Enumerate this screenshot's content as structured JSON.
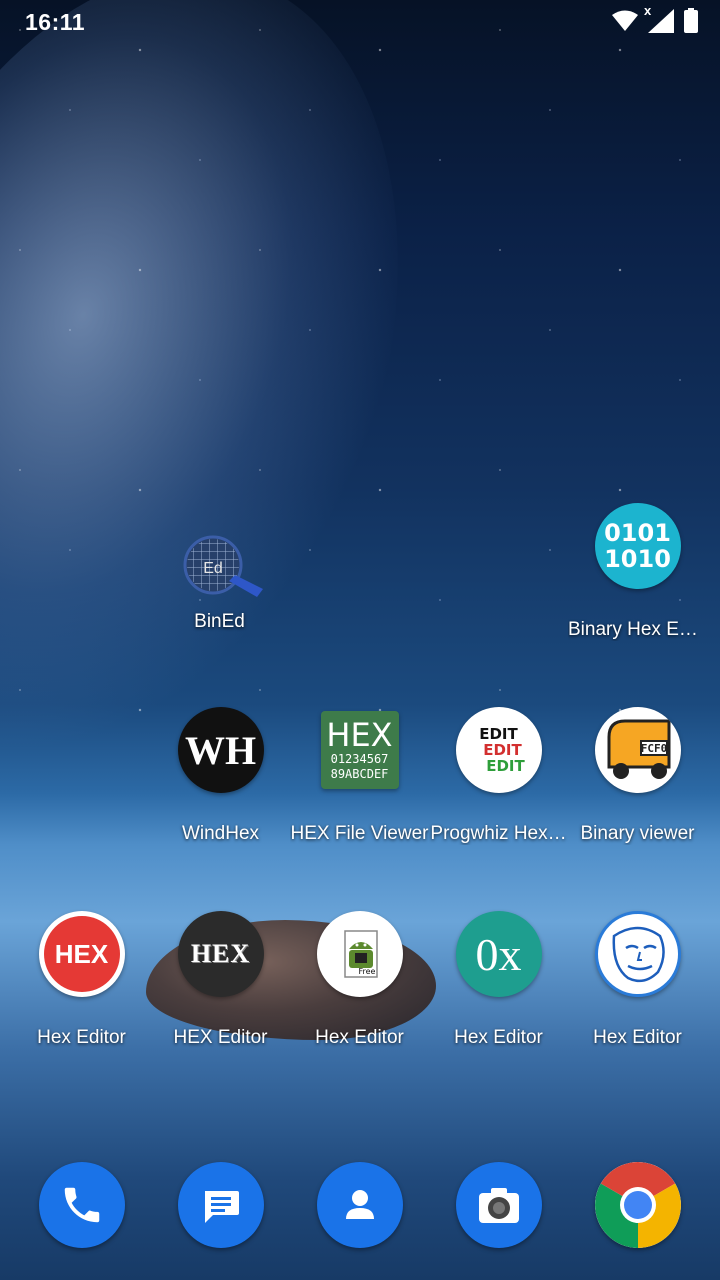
{
  "status_bar": {
    "time": "16:11",
    "icons": [
      "wifi-icon",
      "x-mark-icon",
      "signal-icon",
      "battery-icon"
    ]
  },
  "apps": [
    {
      "name": "bined",
      "label": "BinEd",
      "icon": "magnifier-grid-icon"
    },
    {
      "name": "binary-hex-editor",
      "label": "Binary Hex Edi…",
      "icon": "binary-0101-icon"
    },
    {
      "name": "windhex",
      "label": "WindHex",
      "icon": "wh-logo-icon"
    },
    {
      "name": "hex-file-viewer",
      "label": "HEX File Viewer",
      "icon": "hex-0123-icon"
    },
    {
      "name": "progwhiz-hex",
      "label": "Progwhiz Hex…",
      "icon": "edit-stack-icon"
    },
    {
      "name": "binary-viewer",
      "label": "Binary viewer",
      "icon": "fcf0-truck-icon"
    },
    {
      "name": "hex-editor-1",
      "label": "Hex Editor",
      "icon": "hex-red-icon"
    },
    {
      "name": "hex-editor-2",
      "label": "HEX Editor",
      "icon": "hex-dark-icon"
    },
    {
      "name": "hex-editor-3",
      "label": "Hex Editor",
      "icon": "android-free-icon"
    },
    {
      "name": "hex-editor-4",
      "label": "Hex Editor",
      "icon": "0x-icon"
    },
    {
      "name": "hex-editor-5",
      "label": "Hex Editor",
      "icon": "face-sketch-icon"
    }
  ],
  "icon_text": {
    "bined": "Ed",
    "binary_hex": [
      "0101",
      "1010"
    ],
    "windhex": "WH",
    "hex_file_viewer": [
      "HEX",
      "01234567",
      "89ABCDEF"
    ],
    "progwhiz": [
      "EDIT",
      "EDIT",
      "EDIT"
    ],
    "binary_viewer": "FCF0",
    "hex_red": "HEX",
    "hex_dark": "HEX",
    "android_free": "Free",
    "zero_x": "0x"
  },
  "dock": [
    {
      "name": "phone",
      "icon": "phone-icon"
    },
    {
      "name": "messages",
      "icon": "message-icon"
    },
    {
      "name": "contacts",
      "icon": "contact-icon"
    },
    {
      "name": "camera",
      "icon": "camera-icon"
    },
    {
      "name": "chrome",
      "icon": "chrome-icon"
    }
  ],
  "colors": {
    "dock_blue": "#1a73e8",
    "binary_teal": "#1cb4cf",
    "hex_red": "#e53935",
    "zero_x_teal": "#1e9e8f"
  }
}
